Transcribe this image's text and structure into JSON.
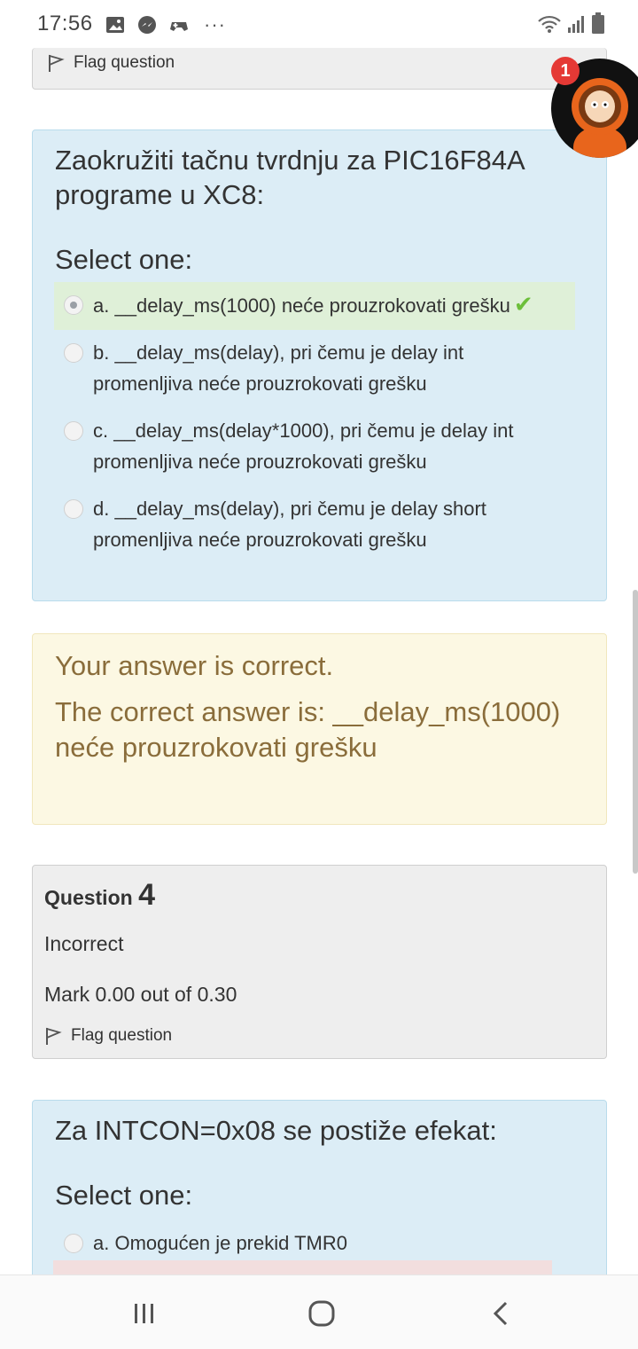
{
  "status_bar": {
    "time": "17:56",
    "icons_left": [
      "gallery-icon",
      "messenger-icon",
      "game-icon",
      "more-dots-icon"
    ],
    "icons_right": [
      "wifi-icon",
      "signal-icon",
      "battery-icon"
    ]
  },
  "prev_question": {
    "flag_label": "Flag question"
  },
  "chat_head": {
    "badge_count": "1"
  },
  "question3": {
    "text": "Zaokružiti tačnu tvrdnju za PIC16F84A programe u XC8:",
    "select_label": "Select one:",
    "options": [
      {
        "letter": "a.",
        "label": "__delay_ms(1000) neće prouzrokovati grešku",
        "selected": true,
        "correct": true
      },
      {
        "letter": "b.",
        "label": "__delay_ms(delay), pri čemu je delay int promenljiva neće prouzrokovati grešku",
        "selected": false
      },
      {
        "letter": "c.",
        "label": "__delay_ms(delay*1000), pri čemu je delay int promenljiva neće prouzrokovati grešku",
        "selected": false
      },
      {
        "letter": "d.",
        "label": "__delay_ms(delay), pri čemu je delay short promenljiva neće prouzrokovati grešku",
        "selected": false
      }
    ],
    "feedback_status": "Your answer is correct.",
    "feedback_answer": "The correct answer is: __delay_ms(1000) neće prouzrokovati grešku"
  },
  "question4": {
    "label": "Question",
    "number": "4",
    "state": "Incorrect",
    "mark": "Mark 0.00 out of 0.30",
    "flag_label": "Flag question",
    "text": "Za INTCON=0x08 se postiže efekat:",
    "select_label": "Select one:",
    "options": [
      {
        "letter": "a.",
        "label": "Omogućen je prekid TMR0",
        "selected": false
      }
    ]
  },
  "colors": {
    "question_bg": "#dcedf6",
    "correct_bg": "#dff0d8",
    "feedback_bg": "#fcf8e3",
    "feedback_text": "#8a6d3b",
    "info_bg": "#eeeeee",
    "badge": "#e53935",
    "check": "#6cbf3a"
  }
}
